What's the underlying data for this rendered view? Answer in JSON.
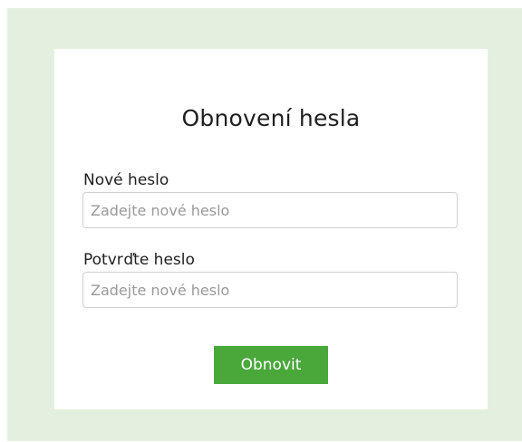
{
  "form": {
    "title": "Obnovení hesla",
    "new_password": {
      "label": "Nové heslo",
      "placeholder": "Zadejte nové heslo",
      "value": ""
    },
    "confirm_password": {
      "label": "Potvrďte heslo",
      "placeholder": "Zadejte nové heslo",
      "value": ""
    },
    "submit_label": "Obnovit"
  },
  "colors": {
    "page_background": "#e4f0df",
    "card_background": "#ffffff",
    "button_background": "#4aa83b",
    "button_text": "#ffffff",
    "input_border": "#cfcfcf"
  }
}
